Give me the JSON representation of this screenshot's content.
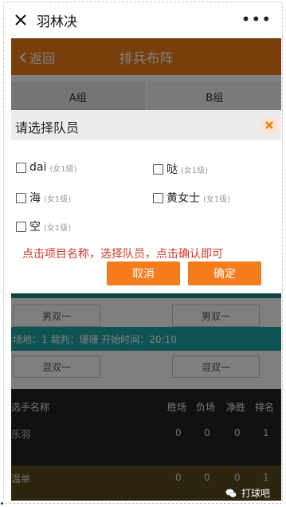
{
  "wechat": {
    "title": "羽林决",
    "more": "•••"
  },
  "app": {
    "back_label": "返回",
    "title": "排兵布阵",
    "group_tabs": [
      "A组",
      "B组"
    ],
    "event_rows": [
      {
        "left": "男双一",
        "right": "男双一"
      },
      {
        "left": "混双一",
        "right": "混双一"
      }
    ],
    "info": "场地：1   裁判：珊珊   开始时间：20:10",
    "stats_headers": {
      "name": "选手名称",
      "win": "胜场",
      "lose": "负场",
      "net": "净胜",
      "rank": "排名"
    },
    "stats_rows": [
      {
        "name": "乐羽",
        "win": "0",
        "lose": "0",
        "net": "0",
        "rank": "1"
      },
      {
        "name": "温单",
        "win": "0",
        "lose": "0",
        "net": "0",
        "rank": "1"
      }
    ]
  },
  "modal": {
    "title": "请选择队员",
    "players": [
      {
        "name": "dai",
        "level": "(女1级)"
      },
      {
        "name": "哒",
        "level": "(女1级)"
      },
      {
        "name": "海",
        "level": "(女1级)"
      },
      {
        "name": "黄女士",
        "level": "(女1级)"
      },
      {
        "name": "空",
        "level": "(女1级)"
      }
    ],
    "hint": "点击项目名称，选择队员，点击确认即可",
    "cancel_label": "取消",
    "confirm_label": "确定",
    "colors": {
      "accent": "#f47c1d",
      "hint": "#d0382a",
      "teal": "#21a7a6"
    }
  },
  "watermark": {
    "text": "打球吧"
  }
}
